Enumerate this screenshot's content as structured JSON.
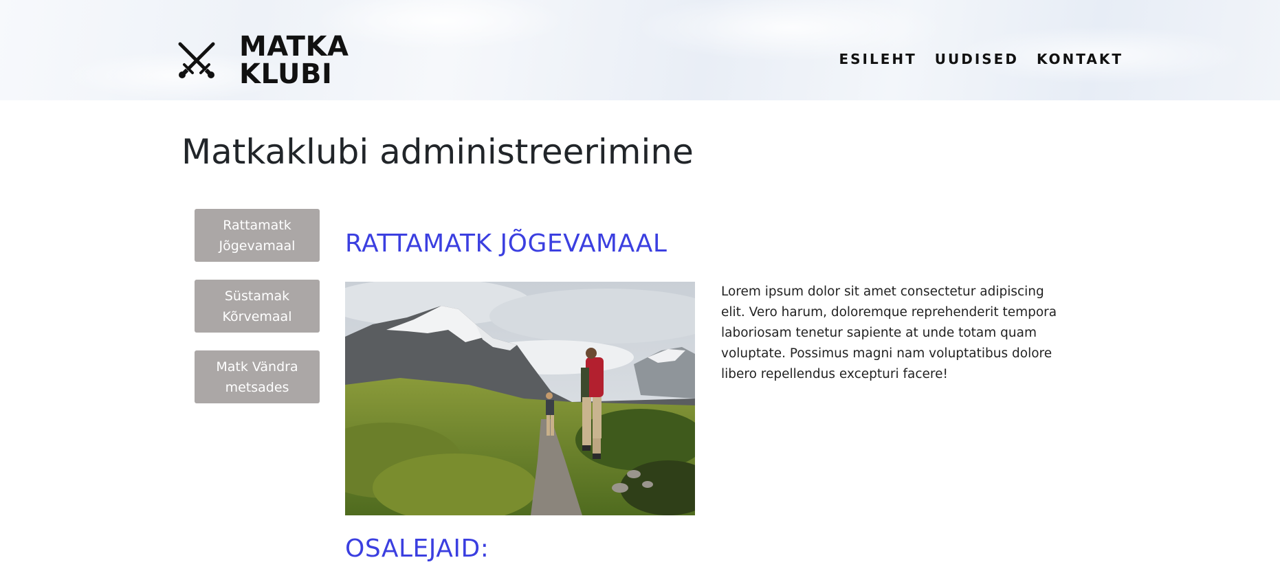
{
  "header": {
    "logo_line1": "MATKA",
    "logo_line2": "KLUBI",
    "logo_icon": "crossed-swords-icon",
    "nav": [
      "ESILEHT",
      "UUDISED",
      "KONTAKT"
    ]
  },
  "page": {
    "title": "Matkaklubi administreerimine"
  },
  "sidebar": {
    "trips": [
      {
        "line1": "Rattamatk",
        "line2": "Jõgevamaal"
      },
      {
        "line1": "Süstamak",
        "line2": "Kõrvemaal"
      },
      {
        "line1": "Matk Vändra",
        "line2": "metsades"
      }
    ]
  },
  "trip": {
    "title": "RATTAMATK JÕGEVAMAAL",
    "image_subject": "hikers-mountain-trail-photo",
    "description": "Lorem ipsum dolor sit amet consectetur adipiscing elit. Vero harum, doloremque reprehenderit tempora laboriosam tenetur sapiente at unde totam quam voluptate. Possimus magni nam voluptatibus dolore libero repellendus excepturi facere!",
    "participants_heading": "OSALEJAID:"
  },
  "colors": {
    "accent": "#3b3fe0",
    "button_bg": "#aba7a6",
    "button_text": "#ffffff",
    "text": "#212529"
  }
}
